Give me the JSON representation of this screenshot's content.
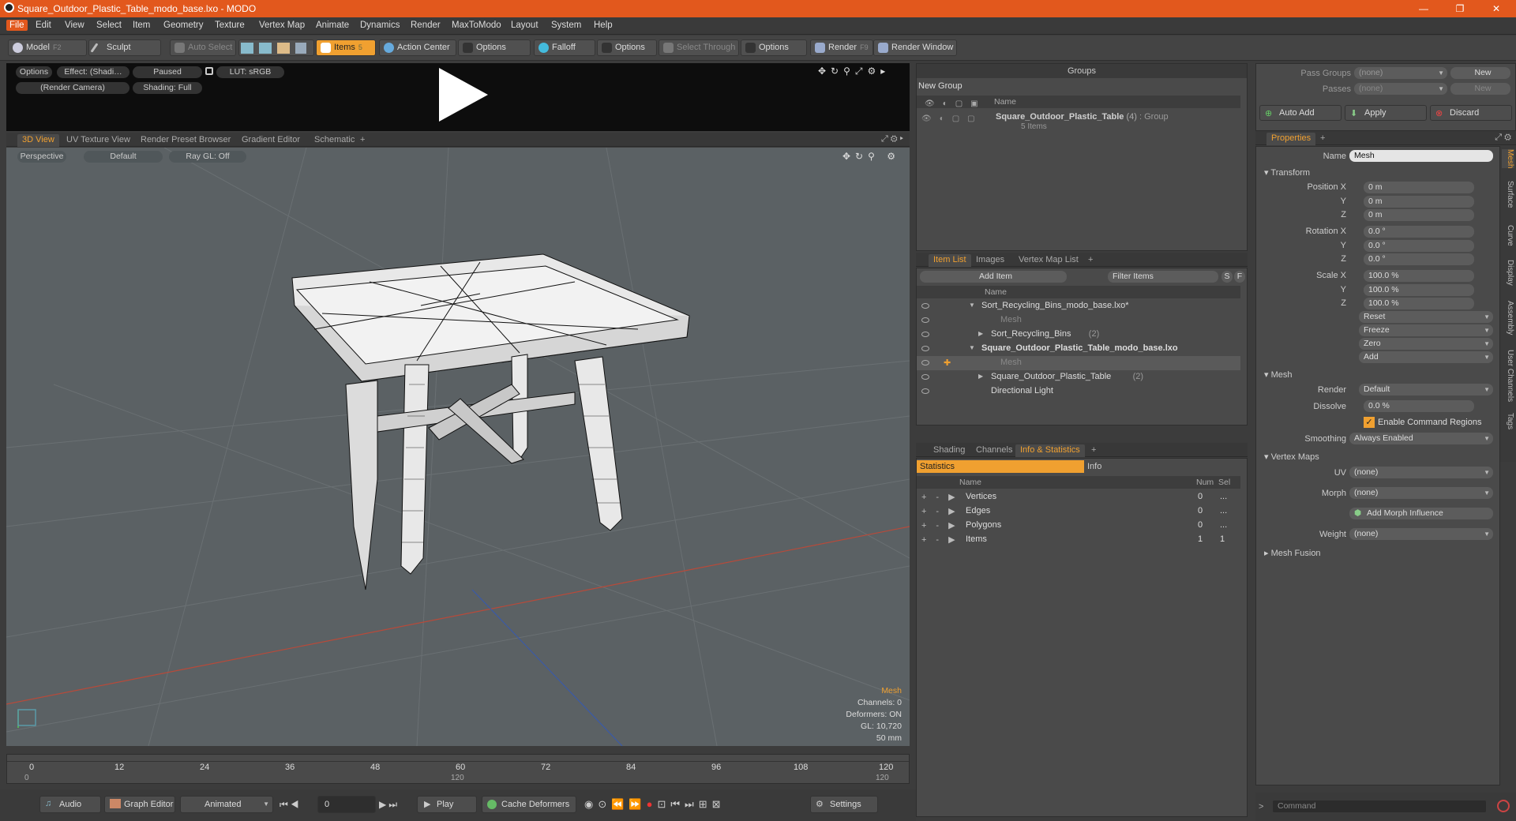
{
  "window": {
    "title": "Square_Outdoor_Plastic_Table_modo_base.lxo - MODO",
    "minimize": "—",
    "restore": "❐",
    "close": "✕"
  },
  "menu": [
    "File",
    "Edit",
    "View",
    "Select",
    "Item",
    "Geometry",
    "Texture",
    "Vertex Map",
    "Animate",
    "Dynamics",
    "Render",
    "MaxToModo",
    "Layout",
    "System",
    "Help"
  ],
  "toolbar": {
    "model": "Model",
    "model_key": "F2",
    "sculpt": "Sculpt",
    "auto_select": "Auto Select",
    "items": "Items",
    "items_key": "5",
    "action_center": "Action Center",
    "options1": "Options",
    "falloff": "Falloff",
    "options2": "Options",
    "select_through": "Select Through",
    "options3": "Options",
    "render": "Render",
    "render_key": "F9",
    "render_window": "Render Window"
  },
  "preview": {
    "options": "Options",
    "effect": "Effect: (Shadi…",
    "paused": "Paused",
    "lut": "LUT: sRGB",
    "camera": "(Render Camera)",
    "shading": "Shading: Full"
  },
  "viewport_tabs": [
    "3D View",
    "UV Texture View",
    "Render Preset Browser",
    "Gradient Editor",
    "Schematic",
    "+"
  ],
  "viewport": {
    "perspective": "Perspective",
    "default": "Default",
    "raygl": "Ray GL: Off",
    "info_title": "Mesh",
    "channels": "Channels: 0",
    "deformers": "Deformers: ON",
    "gl": "GL: 10,720",
    "lens": "50 mm"
  },
  "timeline": {
    "ticks": [
      "0",
      "12",
      "24",
      "36",
      "48",
      "60",
      "72",
      "84",
      "96",
      "108",
      "120"
    ],
    "start": "0",
    "mid": "120",
    "end": "120"
  },
  "bottom": {
    "audio": "Audio",
    "graph_editor": "Graph Editor",
    "animated": "Animated",
    "frame": "0",
    "play": "Play",
    "cache": "Cache Deformers",
    "settings": "Settings"
  },
  "groups": {
    "title": "Groups",
    "new_group": "New Group",
    "col_name": "Name",
    "item_name": "Square_Outdoor_Plastic_Table",
    "item_count": "(4)",
    "item_type": ": Group",
    "item_sub": "5 Items"
  },
  "itemlist": {
    "tabs": [
      "Item List",
      "Images",
      "Vertex Map List",
      "+"
    ],
    "add_item": "Add Item",
    "filter": "Filter Items",
    "s": "S",
    "f": "F",
    "col_name": "Name",
    "rows": [
      {
        "name": "Sort_Recycling_Bins_modo_base.lxo*",
        "bold": false,
        "indent": 0,
        "arrow": "▼"
      },
      {
        "name": "Mesh",
        "bold": false,
        "indent": 2,
        "arrow": "",
        "dim": true
      },
      {
        "name": "Sort_Recycling_Bins",
        "extra": "(2)",
        "bold": false,
        "indent": 1,
        "arrow": "▶"
      },
      {
        "name": "Square_Outdoor_Plastic_Table_modo_base.lxo",
        "bold": true,
        "indent": 0,
        "arrow": "▼"
      },
      {
        "name": "Mesh",
        "bold": false,
        "indent": 2,
        "arrow": "",
        "dim": true,
        "sel": true
      },
      {
        "name": "Square_Outdoor_Plastic_Table",
        "extra": "(2)",
        "bold": false,
        "indent": 1,
        "arrow": "▶"
      },
      {
        "name": "Directional Light",
        "bold": false,
        "indent": 1,
        "arrow": ""
      }
    ]
  },
  "stats": {
    "tabs": [
      "Shading",
      "Channels",
      "Info & Statistics",
      "+"
    ],
    "statistics": "Statistics",
    "info": "Info",
    "col_name": "Name",
    "col_num": "Num",
    "col_sel": "Sel",
    "rows": [
      {
        "name": "Vertices",
        "num": "0",
        "sel": "..."
      },
      {
        "name": "Edges",
        "num": "0",
        "sel": "..."
      },
      {
        "name": "Polygons",
        "num": "0",
        "sel": "..."
      },
      {
        "name": "Items",
        "num": "1",
        "sel": "1"
      }
    ]
  },
  "passes": {
    "pass_groups": "Pass Groups",
    "passes": "Passes",
    "none1": "(none)",
    "none2": "(none)",
    "new1": "New",
    "new2": "New",
    "auto_add": "Auto Add",
    "apply": "Apply",
    "discard": "Discard"
  },
  "properties": {
    "tab": "Properties",
    "plus": "+",
    "name_label": "Name",
    "name_value": "Mesh",
    "transform": "Transform",
    "pos_label": "Position X",
    "px": "0 m",
    "py": "0 m",
    "pz": "0 m",
    "rot_label": "Rotation X",
    "rx": "0.0 °",
    "ry": "0.0 °",
    "rz": "0.0 °",
    "scale_label": "Scale X",
    "sx": "100.0 %",
    "sy": "100.0 %",
    "sz": "100.0 %",
    "y": "Y",
    "z": "Z",
    "reset": "Reset",
    "freeze": "Freeze",
    "zero": "Zero",
    "add": "Add",
    "mesh": "Mesh",
    "render_label": "Render",
    "render_value": "Default",
    "dissolve_label": "Dissolve",
    "dissolve_value": "0.0 %",
    "enable_cmd": "Enable Command Regions",
    "smoothing_label": "Smoothing",
    "smoothing_value": "Always Enabled",
    "vertex_maps": "Vertex Maps",
    "uv_label": "UV",
    "uv_value": "(none)",
    "morph_label": "Morph",
    "morph_value": "(none)",
    "add_morph": "Add Morph Influence",
    "weight_label": "Weight",
    "weight_value": "(none)",
    "mesh_fusion": "Mesh Fusion",
    "side_tabs": [
      "Mesh",
      "Surface",
      "Curve",
      "Display",
      "Assembly",
      "User Channels",
      "Tags"
    ]
  },
  "command": {
    "placeholder": "Command"
  },
  "colors": {
    "accent": "#f0a030",
    "titlebar": "#e2581d",
    "viewport": "#5b6164"
  }
}
